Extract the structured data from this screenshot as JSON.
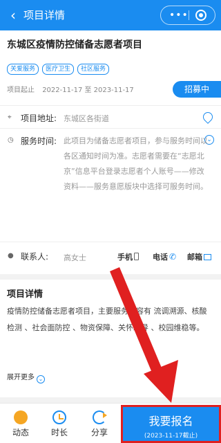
{
  "header": {
    "title": "项目详情",
    "more": "•••"
  },
  "project": {
    "title": "东城区疫情防控储备志愿者项目",
    "tags": [
      "关爱服务",
      "医疗卫生",
      "社区服务"
    ],
    "date_label": "项目起止",
    "date_range": "2022-11-17 至 2023-11-17",
    "status": "招募中"
  },
  "address": {
    "label": "项目地址:",
    "value": "东城区各街道"
  },
  "service": {
    "label": "服务时间:",
    "text": "此项目为储备志愿者项目，参与服务时间以各区通知时间为准。志愿者需要在“志愿北京”信息平台登录志愿者个人账号——修改资料——服务意愿版块中选择可服务时间。"
  },
  "contact": {
    "label": "联系人:",
    "name": "高女士",
    "phone": "手机",
    "tel": "电话",
    "email": "邮箱"
  },
  "detail": {
    "title": "项目详情",
    "body": "疫情防控储备志愿者项目，主要服务内容有 流调溯源、核酸检测 、社会面防控 、物资保障、关怀疏导 、校园维稳等。",
    "expand": "展开更多"
  },
  "bottom": {
    "tabs": [
      "动态",
      "时长",
      "分享"
    ],
    "signup": "我要报名",
    "deadline": "(2023-11-17截止)"
  },
  "colors": {
    "primary": "#1a8cf0",
    "highlight": "#e02020",
    "accent": "#f5a623"
  }
}
